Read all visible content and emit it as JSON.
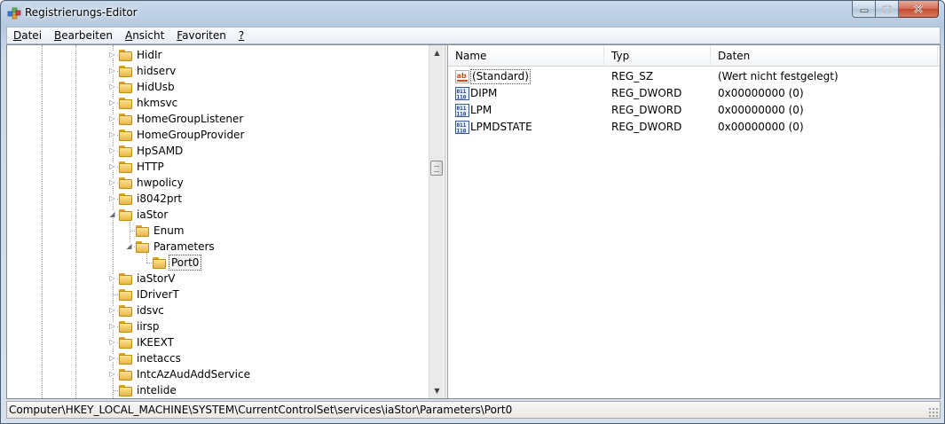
{
  "window": {
    "title": "Registrierungs-Editor",
    "icon": "regedit-icon"
  },
  "menu": {
    "items": [
      {
        "label": "Datei"
      },
      {
        "label": "Bearbeiten"
      },
      {
        "label": "Ansicht"
      },
      {
        "label": "Favoriten"
      },
      {
        "label": "?"
      }
    ]
  },
  "tree": {
    "items": [
      {
        "label": "HidIr",
        "level": 0,
        "expander": "collapsed"
      },
      {
        "label": "hidserv",
        "level": 0,
        "expander": "collapsed"
      },
      {
        "label": "HidUsb",
        "level": 0,
        "expander": "collapsed"
      },
      {
        "label": "hkmsvc",
        "level": 0,
        "expander": "collapsed"
      },
      {
        "label": "HomeGroupListener",
        "level": 0,
        "expander": "collapsed"
      },
      {
        "label": "HomeGroupProvider",
        "level": 0,
        "expander": "collapsed"
      },
      {
        "label": "HpSAMD",
        "level": 0,
        "expander": "collapsed"
      },
      {
        "label": "HTTP",
        "level": 0,
        "expander": "collapsed"
      },
      {
        "label": "hwpolicy",
        "level": 0,
        "expander": "collapsed"
      },
      {
        "label": "i8042prt",
        "level": 0,
        "expander": "collapsed"
      },
      {
        "label": "iaStor",
        "level": 0,
        "expander": "expanded"
      },
      {
        "label": "Enum",
        "level": 1,
        "expander": "none"
      },
      {
        "label": "Parameters",
        "level": 1,
        "expander": "expanded"
      },
      {
        "label": "Port0",
        "level": 2,
        "expander": "none",
        "selected": true
      },
      {
        "label": "iaStorV",
        "level": 0,
        "expander": "collapsed"
      },
      {
        "label": "IDriverT",
        "level": 0,
        "expander": "none"
      },
      {
        "label": "idsvc",
        "level": 0,
        "expander": "collapsed"
      },
      {
        "label": "iirsp",
        "level": 0,
        "expander": "collapsed"
      },
      {
        "label": "IKEEXT",
        "level": 0,
        "expander": "collapsed"
      },
      {
        "label": "inetaccs",
        "level": 0,
        "expander": "collapsed"
      },
      {
        "label": "IntcAzAudAddService",
        "level": 0,
        "expander": "collapsed"
      },
      {
        "label": "intelide",
        "level": 0,
        "expander": "none"
      }
    ]
  },
  "list": {
    "headers": {
      "name": "Name",
      "type": "Typ",
      "data": "Daten"
    },
    "rows": [
      {
        "name": "(Standard)",
        "type": "REG_SZ",
        "data": "(Wert nicht festgelegt)",
        "icon": "string-value-icon",
        "selected": true
      },
      {
        "name": "DIPM",
        "type": "REG_DWORD",
        "data": "0x00000000 (0)",
        "icon": "binary-value-icon"
      },
      {
        "name": "LPM",
        "type": "REG_DWORD",
        "data": "0x00000000 (0)",
        "icon": "binary-value-icon"
      },
      {
        "name": "LPMDSTATE",
        "type": "REG_DWORD",
        "data": "0x00000000 (0)",
        "icon": "binary-value-icon"
      }
    ]
  },
  "status": {
    "path": "Computer\\HKEY_LOCAL_MACHINE\\SYSTEM\\CurrentControlSet\\services\\iaStor\\Parameters\\Port0"
  },
  "colors": {
    "frame": "#b5c9e0",
    "close_button": "#c44a30",
    "folder": "#e9b644"
  }
}
